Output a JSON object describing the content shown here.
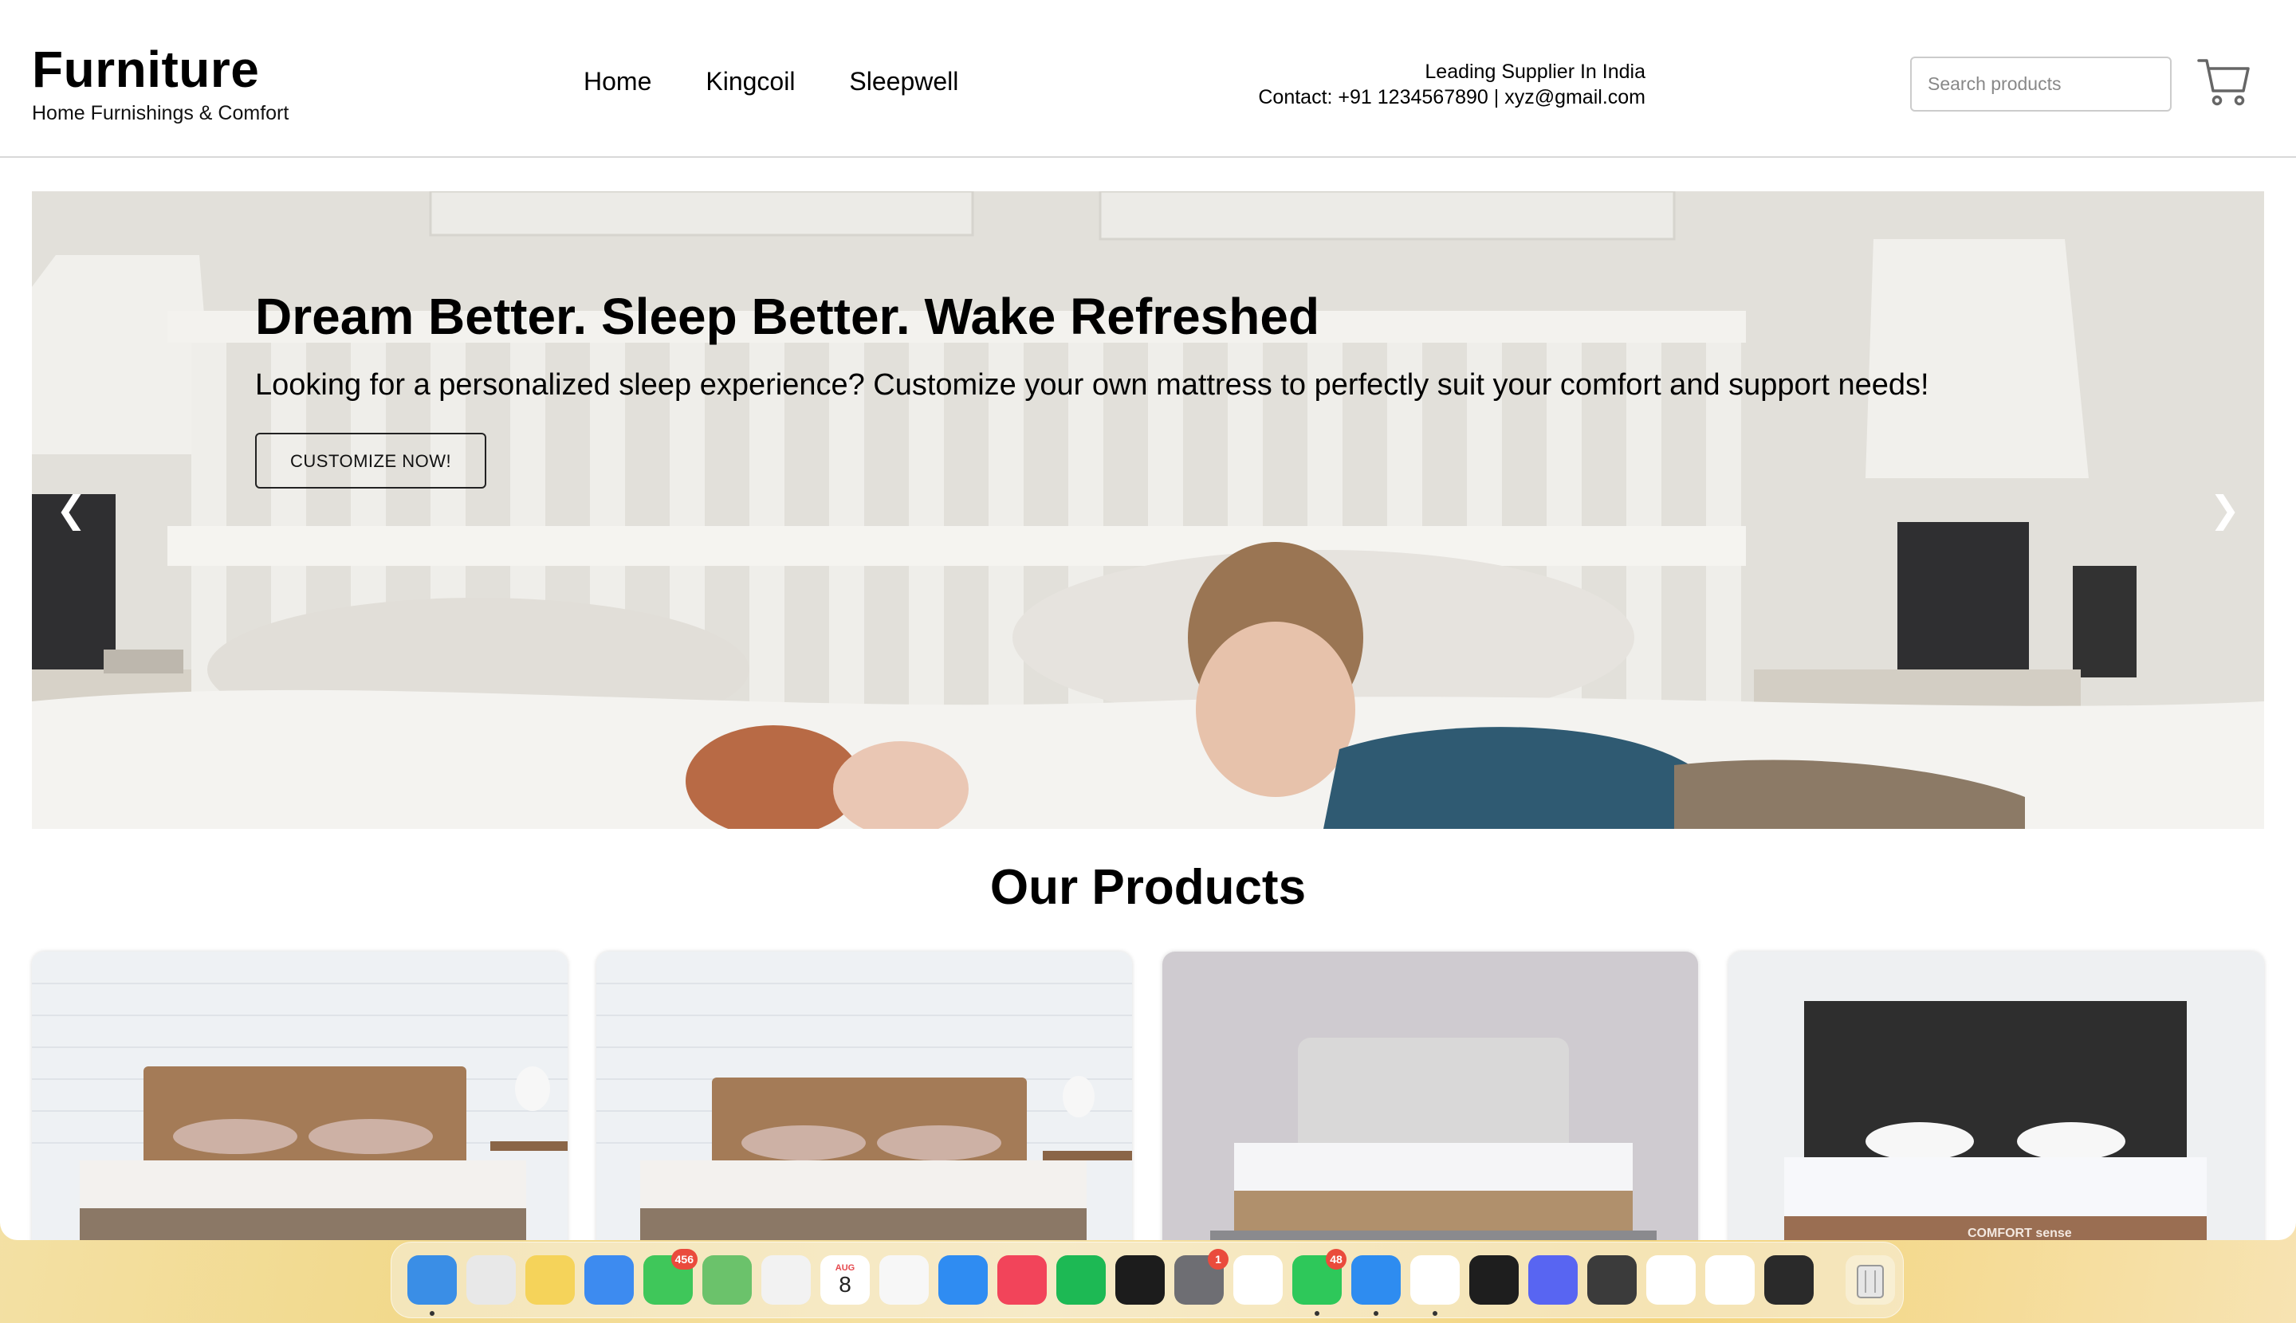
{
  "header": {
    "brand_title": "Furniture",
    "brand_subtitle": "Home Furnishings & Comfort",
    "nav": [
      "Home",
      "Kingcoil",
      "Sleepwell"
    ],
    "contact_line1": "Leading Supplier In India",
    "contact_line2": "Contact: +91 1234567890 | xyz@gmail.com",
    "search_placeholder": "Search products",
    "cart_icon": "cart-icon"
  },
  "hero": {
    "title": "Dream Better. Sleep Better. Wake Refreshed",
    "subtitle": "Looking for a personalized sleep experience? Customize your own mattress to perfectly suit your comfort and support needs!",
    "cta_label": "CUSTOMIZE NOW!",
    "prev_arrow": "❮",
    "next_arrow": "❯"
  },
  "products": {
    "title": "Our Products",
    "items": [
      {
        "image": "mattress-wood-headboard-brick-wall"
      },
      {
        "image": "mattress-wood-headboard-brick-wall-2"
      },
      {
        "image": "mattress-grey-headboard"
      },
      {
        "image": "mattress-black-headboard",
        "label_text": "COMFORT sense"
      }
    ]
  },
  "dock": {
    "apps": [
      {
        "name": "finder",
        "color": "#3a8ee6",
        "running": true
      },
      {
        "name": "launchpad",
        "color": "#e8e8e8"
      },
      {
        "name": "notes",
        "color": "#f5d35a"
      },
      {
        "name": "mail",
        "color": "#3d8bf0"
      },
      {
        "name": "messages",
        "color": "#3fc75a",
        "badge": "456"
      },
      {
        "name": "maps",
        "color": "#6bc26b"
      },
      {
        "name": "photos",
        "color": "#f2f2f2"
      },
      {
        "name": "calendar",
        "color": "#ffffff",
        "cal_month": "AUG",
        "cal_day": "8"
      },
      {
        "name": "reminders",
        "color": "#f7f7f7"
      },
      {
        "name": "app-store",
        "color": "#2f8cf2"
      },
      {
        "name": "music",
        "color": "#f2445a"
      },
      {
        "name": "spotify",
        "color": "#1db954"
      },
      {
        "name": "clock",
        "color": "#1c1c1c"
      },
      {
        "name": "system-settings",
        "color": "#6e6e73",
        "badge": "1"
      },
      {
        "name": "chrome",
        "color": "#ffffff"
      },
      {
        "name": "whatsapp",
        "color": "#2ec85a",
        "badge": "48",
        "running": true
      },
      {
        "name": "safari",
        "color": "#2e8cf0",
        "running": true
      },
      {
        "name": "vscode",
        "color": "#ffffff",
        "running": true
      },
      {
        "name": "figma",
        "color": "#1e1e1e"
      },
      {
        "name": "discord",
        "color": "#5865f2"
      },
      {
        "name": "sublime-text",
        "color": "#3b3b3b"
      },
      {
        "name": "opera",
        "color": "#ffffff"
      },
      {
        "name": "excel",
        "color": "#ffffff"
      },
      {
        "name": "quicktime",
        "color": "#2a2a2a"
      }
    ],
    "trash": "trash-icon"
  },
  "colors": {
    "accent_text": "#000000",
    "header_border": "#d8d8d8",
    "desktop": "#f3d98c"
  }
}
